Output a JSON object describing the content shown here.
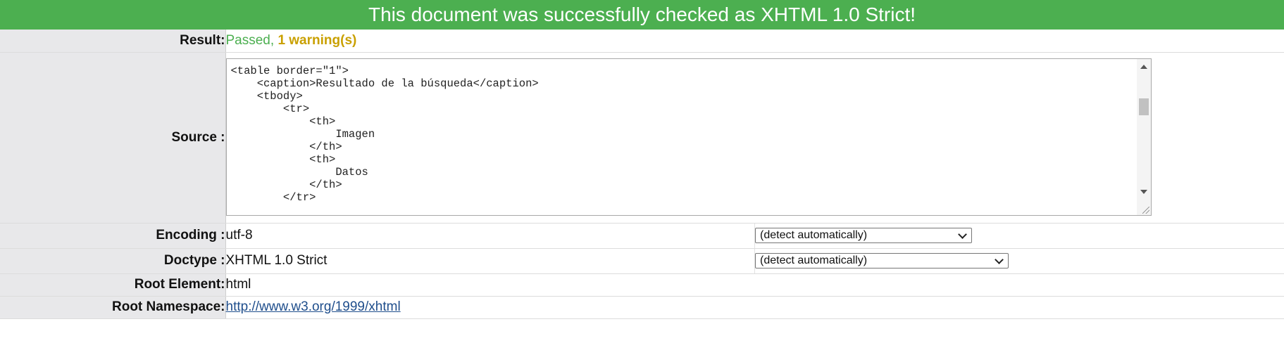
{
  "banner": {
    "text": "This document was successfully checked as XHTML 1.0 Strict!"
  },
  "colors": {
    "banner": "#4caf50",
    "pass": "#4caf50",
    "warning": "#c9a000",
    "label_bg": "#e8e8ea",
    "link": "#1f4e8c"
  },
  "result": {
    "label": "Result:",
    "passed": "Passed, ",
    "warnings": "1 warning(s)"
  },
  "source": {
    "label": "Source :",
    "lines": [
      "<table border=\"1\">",
      "    <caption>Resultado de la búsqueda</caption>",
      "    <tbody>",
      "        <tr>",
      "            <th>",
      "                Imagen",
      "            </th>",
      "            <th>",
      "                Datos",
      "            </th>",
      "        </tr>"
    ]
  },
  "encoding": {
    "label": "Encoding :",
    "value": "utf-8",
    "select": "(detect automatically)"
  },
  "doctype": {
    "label": "Doctype :",
    "value": "XHTML 1.0 Strict",
    "select": "(detect automatically)"
  },
  "root_element": {
    "label": "Root Element:",
    "value": "html"
  },
  "root_namespace": {
    "label": "Root Namespace:",
    "value": "http://www.w3.org/1999/xhtml"
  },
  "icons": [
    "scroll-up-arrow-icon",
    "scroll-down-arrow-icon",
    "resize-handle-icon",
    "chevron-down-icon"
  ]
}
